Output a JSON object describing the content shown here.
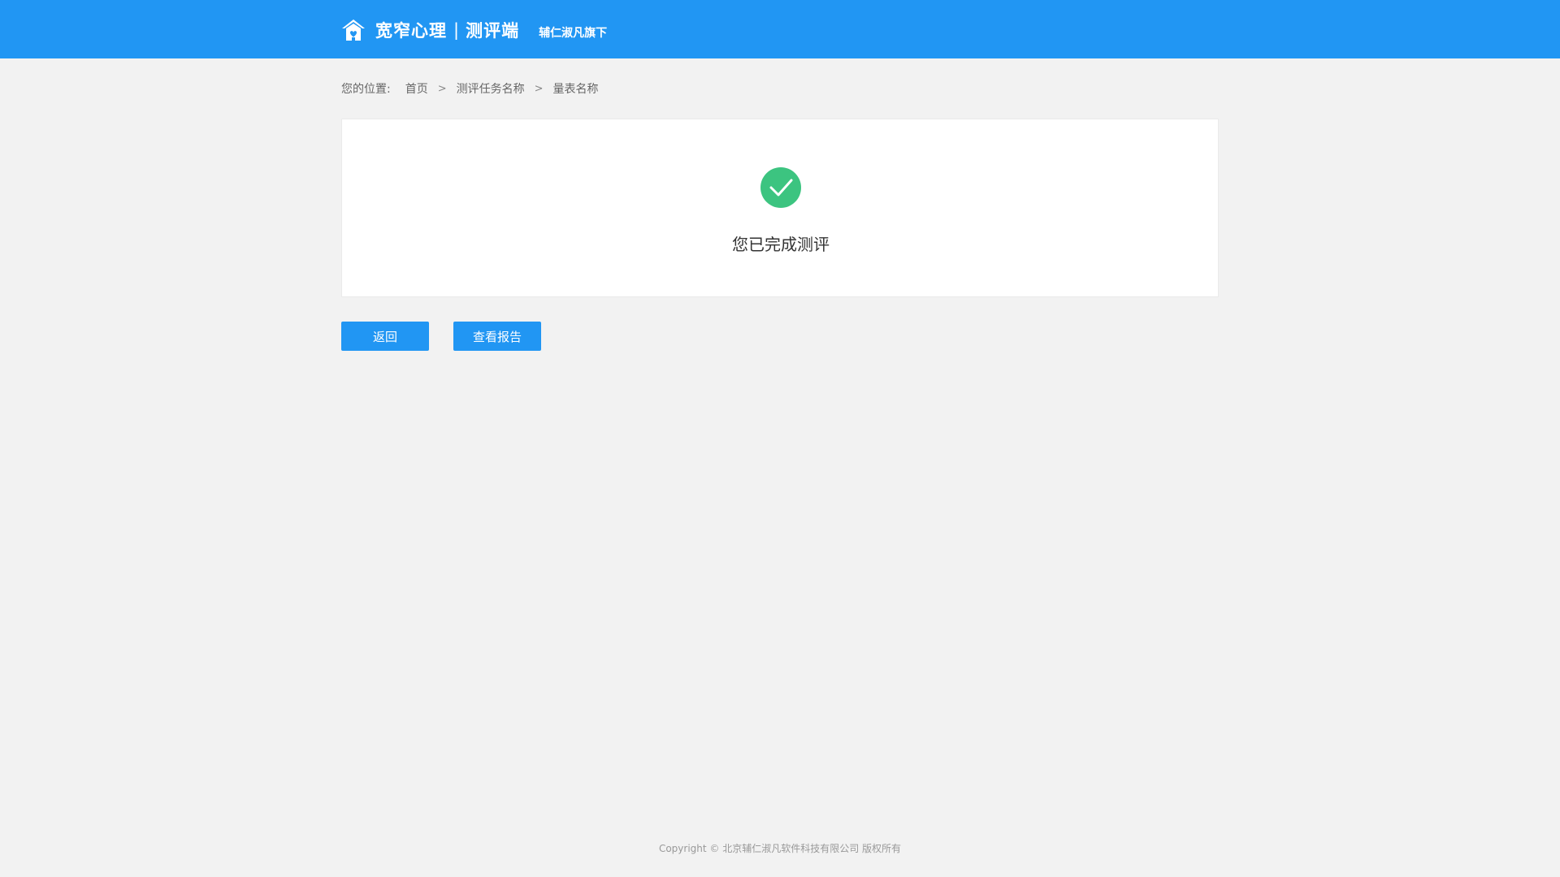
{
  "header": {
    "brand": "宽窄心理",
    "separator": "|",
    "brand_sub": "测评端",
    "tagline": "辅仁淑凡旗下",
    "logo_icon": "home-icon"
  },
  "breadcrumb": {
    "prefix": "您的位置:",
    "items": [
      "首页",
      "测评任务名称",
      "量表名称"
    ],
    "separator_icon": "chevron-right-icon"
  },
  "result": {
    "icon": "check-circle-icon",
    "icon_color": "#3cc480",
    "message": "您已完成测评"
  },
  "actions": {
    "back_label": "返回",
    "report_label": "查看报告"
  },
  "footer": {
    "copyright": "Copyright © 北京辅仁淑凡软件科技有限公司 版权所有"
  },
  "colors": {
    "primary": "#2196f3",
    "background": "#f2f2f2"
  }
}
